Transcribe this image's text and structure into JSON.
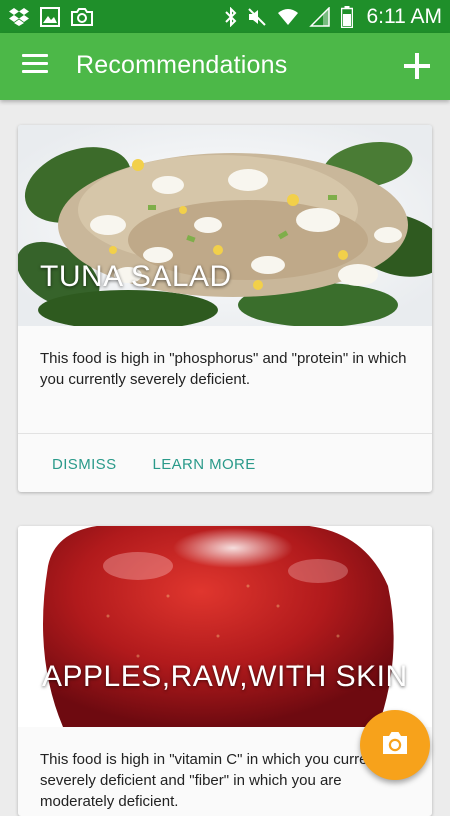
{
  "status_bar": {
    "time": "6:11 AM",
    "icons": [
      "dropbox-icon",
      "gallery-icon",
      "camera-notification-icon",
      "bluetooth-icon",
      "mute-icon",
      "wifi-icon",
      "signal-icon",
      "battery-icon"
    ]
  },
  "app_bar": {
    "title": "Recommendations",
    "menu_icon": "hamburger-menu-icon",
    "add_icon": "plus-icon"
  },
  "cards": [
    {
      "title": "TUNA SALAD",
      "image": "tuna-salad-photo",
      "text": "This food is high in \"phosphorus\" and \"protein\" in which you currently severely deficient.",
      "actions": [
        "DISMISS",
        "LEARN MORE"
      ]
    },
    {
      "title": "APPLES,RAW,WITH SKIN",
      "image": "red-apple-photo",
      "text": "This food is high in \"vitamin C\" in which you currently severely deficient and \"fiber\" in which you are moderately deficient."
    }
  ],
  "fab": {
    "icon": "camera-icon"
  },
  "colors": {
    "status_bar": "#1f8f2a",
    "app_bar": "#4cb848",
    "accent_text": "#2a9a8a",
    "fab": "#f7a21b"
  }
}
